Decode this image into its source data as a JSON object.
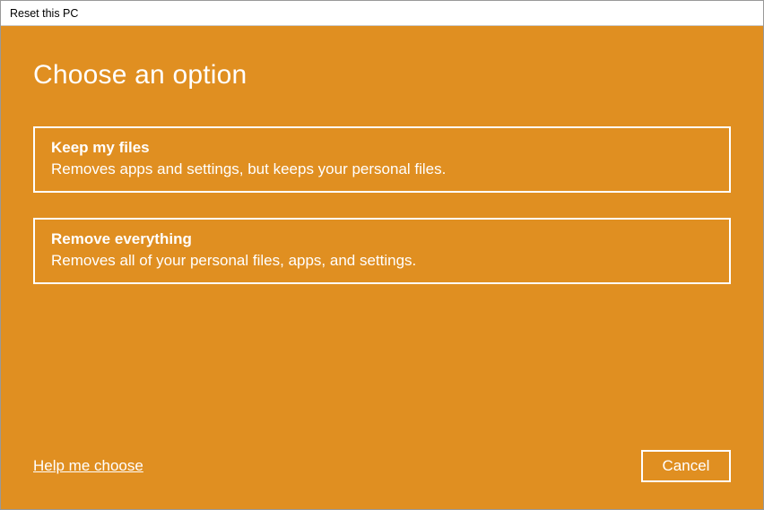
{
  "window": {
    "title": "Reset this PC"
  },
  "main": {
    "heading": "Choose an option",
    "options": [
      {
        "title": "Keep my files",
        "description": "Removes apps and settings, but keeps your personal files."
      },
      {
        "title": "Remove everything",
        "description": "Removes all of your personal files, apps, and settings."
      }
    ]
  },
  "footer": {
    "help_link": "Help me choose",
    "cancel_label": "Cancel"
  }
}
